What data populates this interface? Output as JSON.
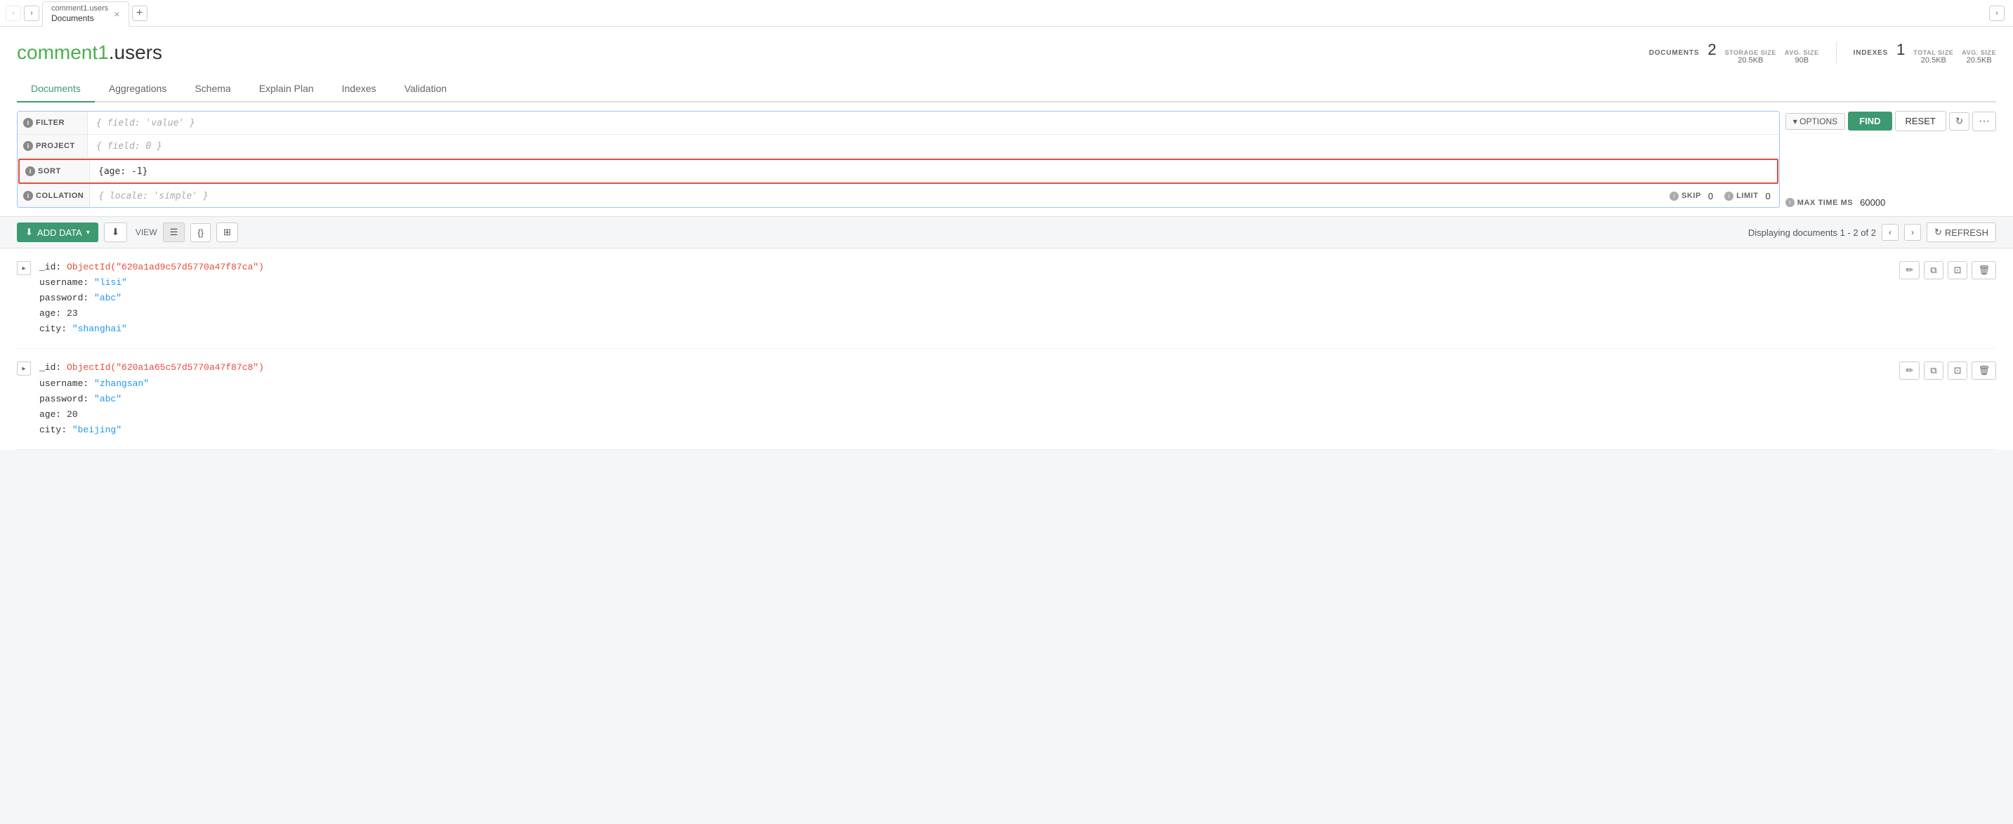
{
  "tab": {
    "title": "comment1.users",
    "label": "Documents",
    "close_icon": "×",
    "add_icon": "+"
  },
  "collection": {
    "db": "comment1",
    "separator": ".",
    "name": "users"
  },
  "stats": {
    "documents_label": "DOCUMENTS",
    "documents_count": "2",
    "storage_size_label": "STORAGE SIZE",
    "storage_size_value": "20.5KB",
    "avg_size_label": "AVG. SIZE",
    "avg_size_value": "90B",
    "indexes_label": "INDEXES",
    "indexes_count": "1",
    "total_size_label": "TOTAL SIZE",
    "total_size_value": "20.5KB",
    "indexes_avg_label": "AVG. SIZE",
    "indexes_avg_value": "20.5KB"
  },
  "nav_tabs": [
    {
      "id": "documents",
      "label": "Documents",
      "active": true
    },
    {
      "id": "aggregations",
      "label": "Aggregations",
      "active": false
    },
    {
      "id": "schema",
      "label": "Schema",
      "active": false
    },
    {
      "id": "explain",
      "label": "Explain Plan",
      "active": false
    },
    {
      "id": "indexes",
      "label": "Indexes",
      "active": false
    },
    {
      "id": "validation",
      "label": "Validation",
      "active": false
    }
  ],
  "query": {
    "filter_label": "FILTER",
    "filter_placeholder": "{ field: 'value' }",
    "project_label": "PROJECT",
    "project_placeholder": "{ field: 0 }",
    "sort_label": "SORT",
    "sort_value": "{age: -1}",
    "collation_label": "COLLATION",
    "collation_placeholder": "{ locale: 'simple' }",
    "options_label": "▾ OPTIONS",
    "find_label": "FIND",
    "reset_label": "RESET",
    "max_time_label": "MAX TIME MS",
    "max_time_value": "60000",
    "skip_label": "SKIP",
    "skip_value": "0",
    "limit_label": "LIMIT",
    "limit_value": "0"
  },
  "toolbar": {
    "add_data_label": "ADD DATA",
    "export_icon": "⬇",
    "view_label": "VIEW",
    "displaying": "Displaying documents 1 - 2 of 2",
    "refresh_label": "REFRESH"
  },
  "documents": [
    {
      "id": "ObjectId(\"620a1ad9c57d5770a47f87ca\")",
      "username": "\"lisi\"",
      "password": "\"abc\"",
      "age": "23",
      "city": "\"shanghai\""
    },
    {
      "id": "ObjectId(\"620a1a65c57d5770a47f87c8\")",
      "username": "\"zhangsan\"",
      "password": "\"abc\"",
      "age": "20",
      "city": "\"beijing\""
    }
  ],
  "colors": {
    "green": "#3D9970",
    "red": "#e74c3c",
    "blue": "#2196F3"
  }
}
